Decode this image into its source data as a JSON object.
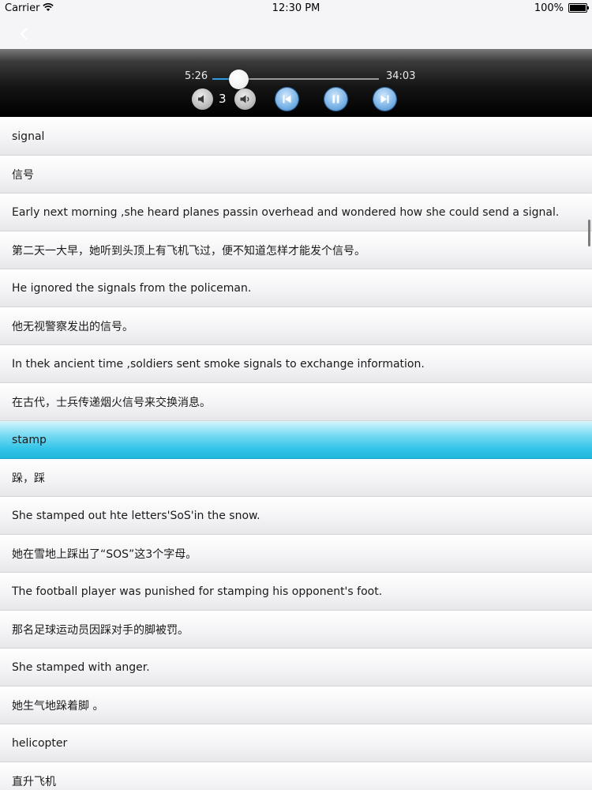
{
  "status_bar": {
    "carrier": "Carrier",
    "time": "12:30 PM",
    "battery": "100%"
  },
  "player": {
    "elapsed": "5:26",
    "total": "34:03",
    "volume": "3",
    "progress": 0.16
  },
  "colors": {
    "accent": "#2d9be6",
    "highlight": "#32c4e8"
  },
  "rows": [
    {
      "text": "signal",
      "highlight": false
    },
    {
      "text": "信号",
      "highlight": false
    },
    {
      "text": "Early next morning ,she heard planes passin overhead and wondered how she could send a signal.",
      "highlight": false
    },
    {
      "text": "第二天一大早，她听到头顶上有飞机飞过，便不知道怎样才能发个信号。",
      "highlight": false
    },
    {
      "text": "He ignored the signals from the policeman.",
      "highlight": false
    },
    {
      "text": "他无视警察发出的信号。",
      "highlight": false
    },
    {
      "text": "In thek ancient time ,soldiers sent smoke signals to exchange information.",
      "highlight": false
    },
    {
      "text": "在古代，士兵传递烟火信号来交换消息。",
      "highlight": false
    },
    {
      "text": "stamp",
      "highlight": true
    },
    {
      "text": "跺，踩",
      "highlight": false
    },
    {
      "text": "She stamped out hte letters'SoS'in the snow.",
      "highlight": false
    },
    {
      "text": "她在雪地上踩出了“SOS”这3个字母。",
      "highlight": false
    },
    {
      "text": "The football player was punished for stamping his opponent's foot.",
      "highlight": false
    },
    {
      "text": "那名足球运动员因踩对手的脚被罚。",
      "highlight": false
    },
    {
      "text": "She stamped with anger.",
      "highlight": false
    },
    {
      "text": "她生气地跺着脚 。",
      "highlight": false
    },
    {
      "text": "helicopter",
      "highlight": false
    },
    {
      "text": "直升飞机",
      "highlight": false
    }
  ]
}
